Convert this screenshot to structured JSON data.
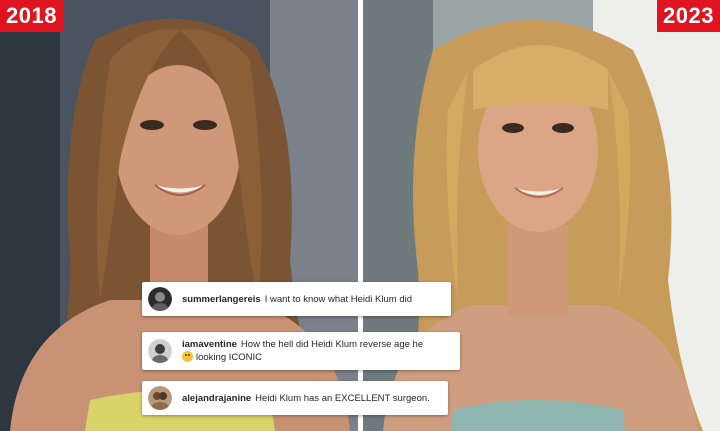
{
  "labels": {
    "year_left": "2018",
    "year_right": "2023"
  },
  "comments": [
    {
      "username": "summerlangereis",
      "text": "I want to know what Heidi Klum did",
      "avatar_icon": "user-avatar-icon"
    },
    {
      "username": "iamaventine",
      "text_part1": "How the hell did Heidi Klum reverse age he",
      "text_part2": "looking ICONIC",
      "emoji_icon": "laughing-emoji-icon",
      "avatar_icon": "user-avatar-icon"
    },
    {
      "username": "alejandrajanine",
      "text": "Heidi Klum has an EXCELLENT surgeon.",
      "avatar_icon": "user-avatar-icon"
    }
  ],
  "colors": {
    "badge_red": "#e0141e",
    "divider": "#ffffff"
  }
}
